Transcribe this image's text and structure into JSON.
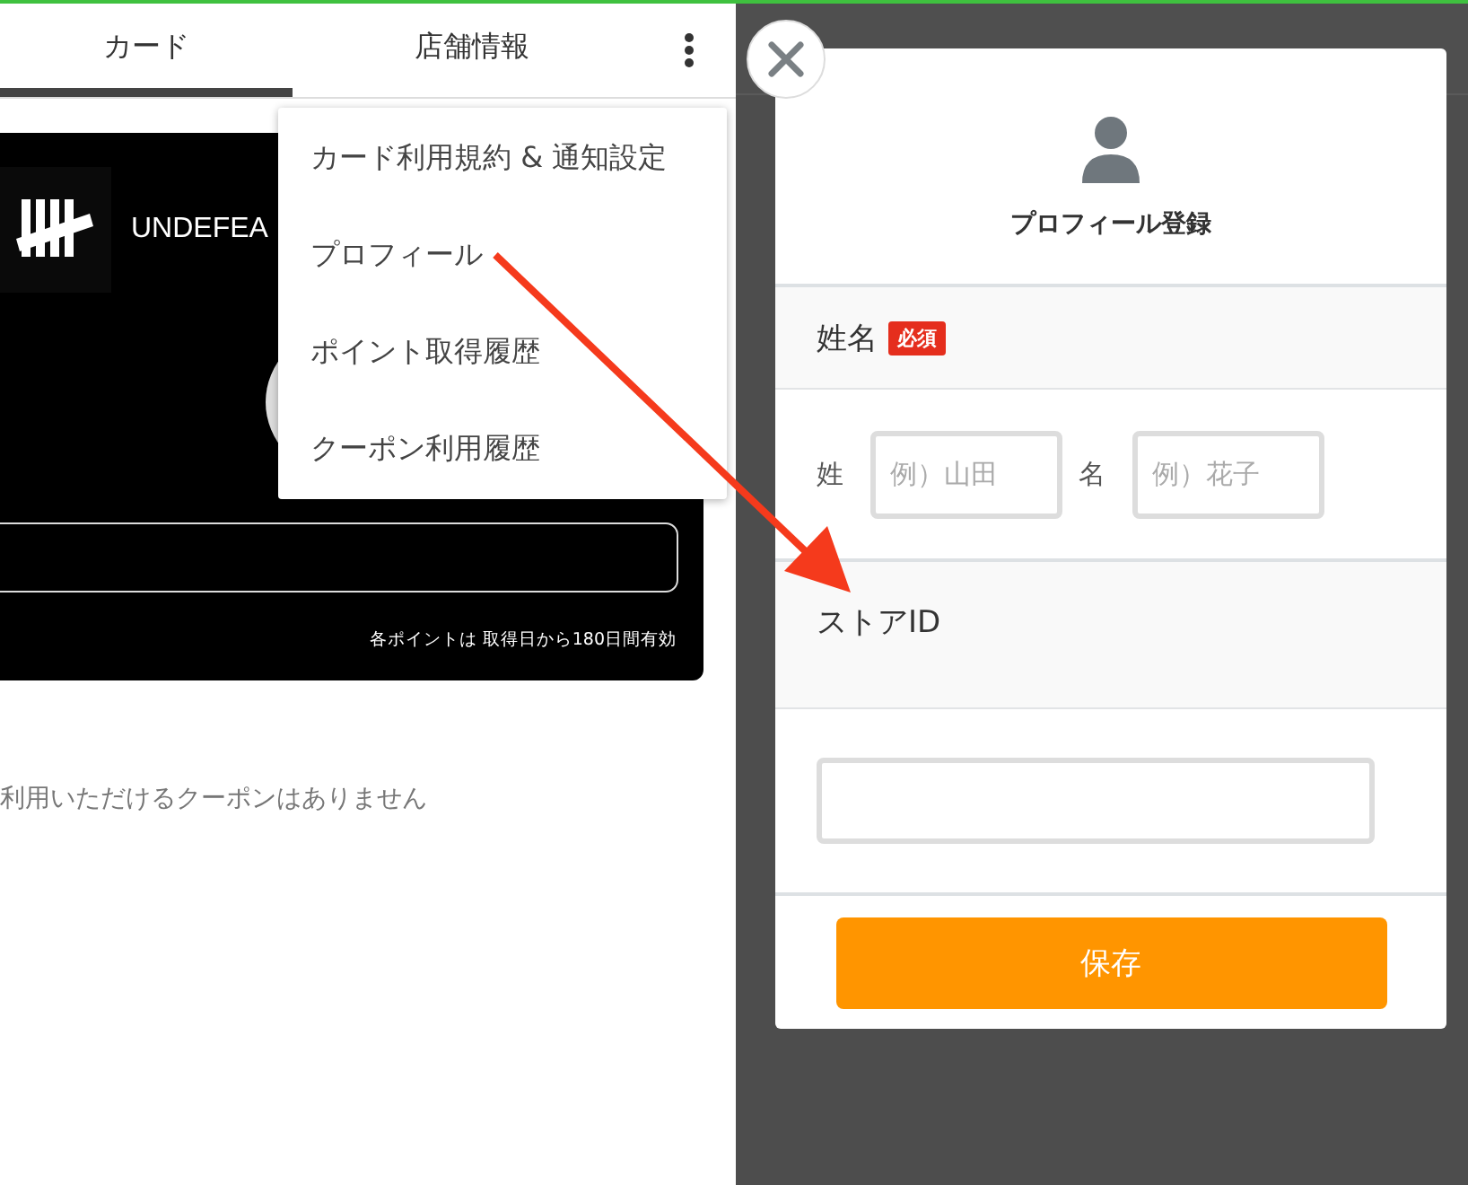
{
  "left": {
    "tabs": [
      {
        "label": "カード",
        "selected": true
      },
      {
        "label": "店舗情報",
        "selected": false
      }
    ],
    "card": {
      "brand": "UNDEFEA",
      "note": "各ポイントは 取得日から180日間有効"
    },
    "empty_message": "利用いただけるクーポンはありません",
    "menu": {
      "items": [
        "カード利用規約 & 通知設定",
        "プロフィール",
        "ポイント取得履歴",
        "クーポン利用履歴"
      ]
    }
  },
  "modal": {
    "title": "プロフィール登録",
    "sections": [
      {
        "kind": "name",
        "label": "姓名",
        "badge": "必須",
        "fields": [
          {
            "label": "姓",
            "placeholder": "例）山田"
          },
          {
            "label": "名",
            "placeholder": "例）花子"
          }
        ]
      },
      {
        "kind": "text",
        "label": "ストアID"
      }
    ],
    "save_button": "保存"
  }
}
